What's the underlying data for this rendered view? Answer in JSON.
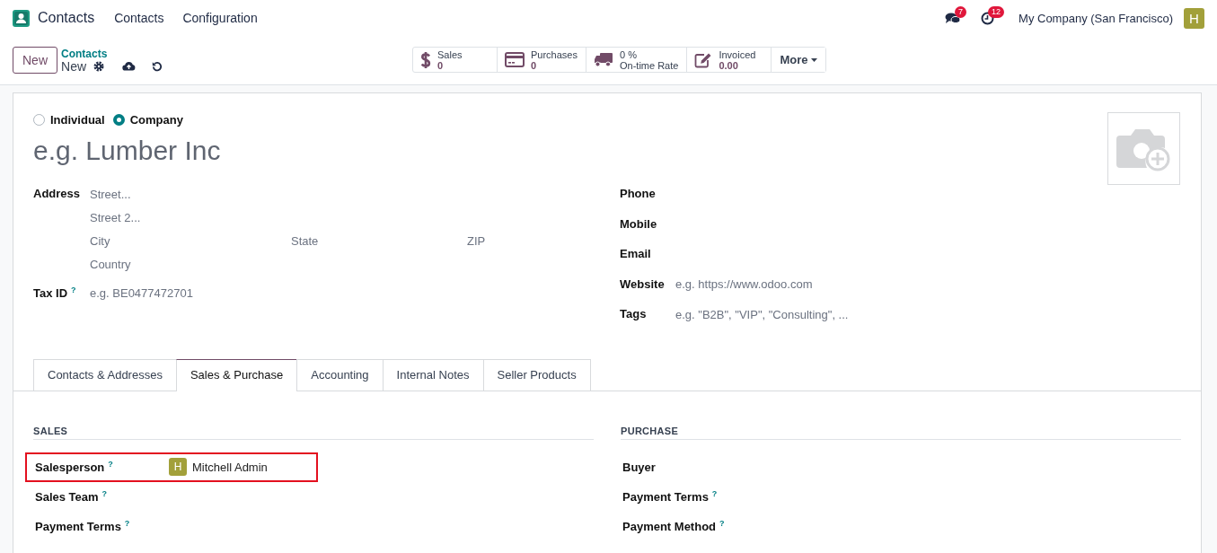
{
  "app": {
    "name": "Contacts"
  },
  "menu": [
    "Contacts",
    "Configuration"
  ],
  "systray": [
    {
      "kind": "chat",
      "badge": "7"
    },
    {
      "kind": "activity",
      "badge": "12"
    }
  ],
  "company": "My Company (San Francisco)",
  "user_avatar": "H",
  "control_panel": {
    "new_button": "New",
    "breadcrumb": "Contacts",
    "record": "New"
  },
  "smart_buttons": [
    {
      "kind": "label_first",
      "label": "Sales",
      "value": "0"
    },
    {
      "kind": "label_first",
      "label": "Purchases",
      "value": "0"
    },
    {
      "kind": "value_first",
      "label": "On-time Rate",
      "value": "0 %"
    },
    {
      "kind": "label_first",
      "label": "Invoiced",
      "value": "0.00"
    }
  ],
  "more_button": "More",
  "company_type": [
    {
      "label": "Individual",
      "selected": false
    },
    {
      "label": "Company",
      "selected": true
    }
  ],
  "name_placeholder": "e.g. Lumber Inc",
  "address": {
    "label": "Address",
    "street": {
      "placeholder": "Street..."
    },
    "street2": {
      "placeholder": "Street 2..."
    },
    "city": {
      "placeholder": "City"
    },
    "state": {
      "placeholder": "State"
    },
    "zip": {
      "placeholder": "ZIP"
    },
    "country": {
      "placeholder": "Country"
    }
  },
  "tax_id": {
    "label": "Tax ID",
    "help": "?",
    "placeholder": "e.g. BE0477472701"
  },
  "contact_fields": [
    {
      "label": "Phone"
    },
    {
      "label": "Mobile"
    },
    {
      "label": "Email"
    },
    {
      "label": "Website",
      "placeholder": "e.g. https://www.odoo.com"
    },
    {
      "label": "Tags",
      "placeholder": "e.g. \"B2B\", \"VIP\", \"Consulting\", ..."
    }
  ],
  "tabs": [
    {
      "label": "Contacts & Addresses",
      "selected": false
    },
    {
      "label": "Sales & Purchase",
      "selected": true
    },
    {
      "label": "Accounting",
      "selected": false
    },
    {
      "label": "Internal Notes",
      "selected": false
    },
    {
      "label": "Seller Products",
      "selected": false
    }
  ],
  "sales": {
    "title": "SALES",
    "fields": [
      {
        "label": "Salesperson",
        "help": "?",
        "avatar": "H",
        "value": "Mitchell Admin",
        "highlighted": true
      },
      {
        "label": "Sales Team",
        "help": "?",
        "highlighted": false
      },
      {
        "label": "Payment Terms",
        "help": "?",
        "highlighted": false
      }
    ]
  },
  "purchase": {
    "title": "PURCHASE",
    "fields": [
      {
        "label": "Buyer",
        "highlighted": false
      },
      {
        "label": "Payment Terms",
        "help": "?",
        "highlighted": false
      },
      {
        "label": "Payment Method",
        "help": "?",
        "highlighted": false
      }
    ]
  }
}
